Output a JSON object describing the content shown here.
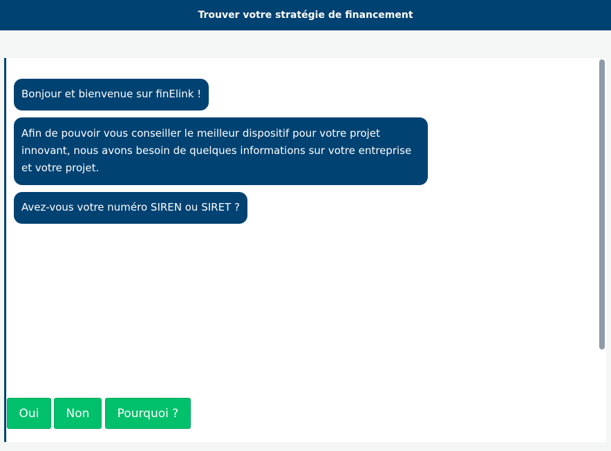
{
  "header": {
    "title": "Trouver votre stratégie de financement"
  },
  "messages": [
    "Bonjour et bienvenue sur finElink !",
    "Afin de pouvoir vous conseiller le meilleur dispositif pour votre projet innovant, nous avons besoin de quelques informations sur votre entreprise et votre projet.",
    "Avez-vous votre numéro SIREN ou SIRET ?"
  ],
  "choices": [
    "Oui",
    "Non",
    "Pourquoi ?"
  ],
  "colors": {
    "header": "#004272",
    "bubble": "#004272",
    "choice": "#00c06b",
    "page_bg": "#f4f6f5"
  }
}
